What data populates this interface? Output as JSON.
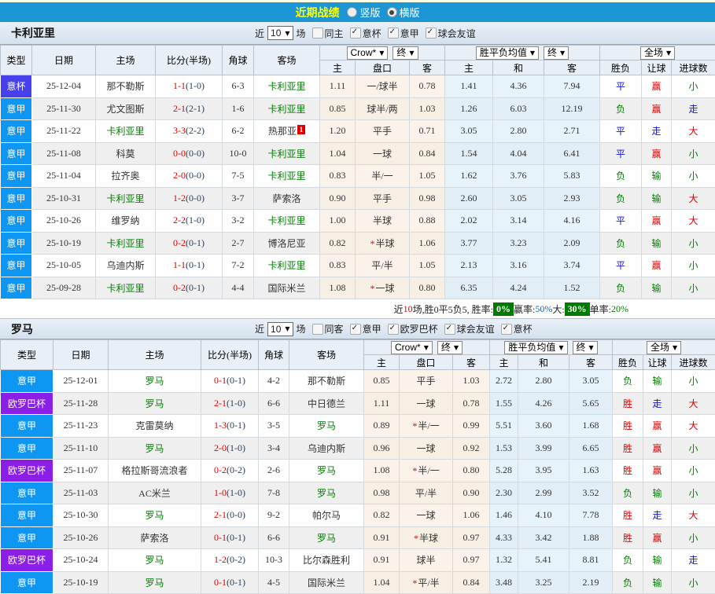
{
  "top_bar": {
    "title": "近期战绩",
    "options": [
      {
        "label": "竖版",
        "selected": false
      },
      {
        "label": "横版",
        "selected": true
      }
    ]
  },
  "league_colors": {
    "意甲": "#0D96F2",
    "意杯": "#4740EC",
    "欧罗巴杯": "#8B1FE8"
  },
  "result_colors": {
    "胜": "#E10000",
    "平": "#1010D8",
    "负": "#008000",
    "赢": "#E10000",
    "走": "#1010D8",
    "输": "#008000",
    "大": "#E10000",
    "小": "#008000"
  },
  "team_highlight_color": "#008000",
  "columns": {
    "left": [
      "类型",
      "日期",
      "主场",
      "比分(半场)",
      "角球",
      "客场"
    ],
    "group1": {
      "dropdown": "Crow*",
      "final": "终",
      "cols": [
        "主",
        "盘口",
        "客"
      ]
    },
    "group2": {
      "dropdown": "胜平负均值",
      "final": "终",
      "cols": [
        "主",
        "和",
        "客"
      ]
    },
    "group3": {
      "dropdown": "全场",
      "cols": [
        "胜负",
        "让球",
        "进球数"
      ]
    }
  },
  "sections": [
    {
      "team": "卡利亚里",
      "filters": {
        "near": "近",
        "count": "10",
        "unit": "场",
        "same": {
          "label": "同主",
          "checked": false
        },
        "leagues": [
          {
            "label": "意杯",
            "checked": true
          },
          {
            "label": "意甲",
            "checked": true
          },
          {
            "label": "球会友谊",
            "checked": true
          }
        ]
      },
      "rows": [
        {
          "league": "意杯",
          "date": "25-12-04",
          "home": "那不勒斯",
          "home_is_team": false,
          "score": "1-1",
          "half": "(1-0)",
          "corners": "6-3",
          "away": "卡利亚里",
          "away_is_team": true,
          "away_badge": "",
          "odds_home": "1.11",
          "handicap": "一/球半",
          "handicap_star": false,
          "odds_away": "0.78",
          "avg_home": "1.41",
          "avg_draw": "4.36",
          "avg_away": "7.94",
          "result": "平",
          "handicap_result": "赢",
          "goals_result": "小"
        },
        {
          "league": "意甲",
          "date": "25-11-30",
          "home": "尤文图斯",
          "home_is_team": false,
          "score": "2-1",
          "half": "(2-1)",
          "corners": "1-6",
          "away": "卡利亚里",
          "away_is_team": true,
          "away_badge": "",
          "odds_home": "0.85",
          "handicap": "球半/两",
          "handicap_star": false,
          "odds_away": "1.03",
          "avg_home": "1.26",
          "avg_draw": "6.03",
          "avg_away": "12.19",
          "result": "负",
          "handicap_result": "赢",
          "goals_result": "走"
        },
        {
          "league": "意甲",
          "date": "25-11-22",
          "home": "卡利亚里",
          "home_is_team": true,
          "score": "3-3",
          "half": "(2-2)",
          "corners": "6-2",
          "away": "热那亚",
          "away_is_team": false,
          "away_badge": "1",
          "odds_home": "1.20",
          "handicap": "平手",
          "handicap_star": false,
          "odds_away": "0.71",
          "avg_home": "3.05",
          "avg_draw": "2.80",
          "avg_away": "2.71",
          "result": "平",
          "handicap_result": "走",
          "goals_result": "大"
        },
        {
          "league": "意甲",
          "date": "25-11-08",
          "home": "科莫",
          "home_is_team": false,
          "score": "0-0",
          "half": "(0-0)",
          "corners": "10-0",
          "away": "卡利亚里",
          "away_is_team": true,
          "away_badge": "",
          "odds_home": "1.04",
          "handicap": "一球",
          "handicap_star": false,
          "odds_away": "0.84",
          "avg_home": "1.54",
          "avg_draw": "4.04",
          "avg_away": "6.41",
          "result": "平",
          "handicap_result": "赢",
          "goals_result": "小"
        },
        {
          "league": "意甲",
          "date": "25-11-04",
          "home": "拉齐奥",
          "home_is_team": false,
          "score": "2-0",
          "half": "(0-0)",
          "corners": "7-5",
          "away": "卡利亚里",
          "away_is_team": true,
          "away_badge": "",
          "odds_home": "0.83",
          "handicap": "半/一",
          "handicap_star": false,
          "odds_away": "1.05",
          "avg_home": "1.62",
          "avg_draw": "3.76",
          "avg_away": "5.83",
          "result": "负",
          "handicap_result": "输",
          "goals_result": "小"
        },
        {
          "league": "意甲",
          "date": "25-10-31",
          "home": "卡利亚里",
          "home_is_team": true,
          "score": "1-2",
          "half": "(0-0)",
          "corners": "3-7",
          "away": "萨索洛",
          "away_is_team": false,
          "away_badge": "",
          "odds_home": "0.90",
          "handicap": "平手",
          "handicap_star": false,
          "odds_away": "0.98",
          "avg_home": "2.60",
          "avg_draw": "3.05",
          "avg_away": "2.93",
          "result": "负",
          "handicap_result": "输",
          "goals_result": "大"
        },
        {
          "league": "意甲",
          "date": "25-10-26",
          "home": "维罗纳",
          "home_is_team": false,
          "score": "2-2",
          "half": "(1-0)",
          "corners": "3-2",
          "away": "卡利亚里",
          "away_is_team": true,
          "away_badge": "",
          "odds_home": "1.00",
          "handicap": "半球",
          "handicap_star": false,
          "odds_away": "0.88",
          "avg_home": "2.02",
          "avg_draw": "3.14",
          "avg_away": "4.16",
          "result": "平",
          "handicap_result": "赢",
          "goals_result": "大"
        },
        {
          "league": "意甲",
          "date": "25-10-19",
          "home": "卡利亚里",
          "home_is_team": true,
          "score": "0-2",
          "half": "(0-1)",
          "corners": "2-7",
          "away": "博洛尼亚",
          "away_is_team": false,
          "away_badge": "",
          "odds_home": "0.82",
          "handicap": "半球",
          "handicap_star": true,
          "odds_away": "1.06",
          "avg_home": "3.77",
          "avg_draw": "3.23",
          "avg_away": "2.09",
          "result": "负",
          "handicap_result": "输",
          "goals_result": "小"
        },
        {
          "league": "意甲",
          "date": "25-10-05",
          "home": "乌迪内斯",
          "home_is_team": false,
          "score": "1-1",
          "half": "(0-1)",
          "corners": "7-2",
          "away": "卡利亚里",
          "away_is_team": true,
          "away_badge": "",
          "odds_home": "0.83",
          "handicap": "平/半",
          "handicap_star": false,
          "odds_away": "1.05",
          "avg_home": "2.13",
          "avg_draw": "3.16",
          "avg_away": "3.74",
          "result": "平",
          "handicap_result": "赢",
          "goals_result": "小"
        },
        {
          "league": "意甲",
          "date": "25-09-28",
          "home": "卡利亚里",
          "home_is_team": true,
          "score": "0-2",
          "half": "(0-1)",
          "corners": "4-4",
          "away": "国际米兰",
          "away_is_team": false,
          "away_badge": "",
          "odds_home": "1.08",
          "handicap": "一球",
          "handicap_star": true,
          "odds_away": "0.80",
          "avg_home": "6.35",
          "avg_draw": "4.24",
          "avg_away": "1.52",
          "result": "负",
          "handicap_result": "输",
          "goals_result": "小"
        }
      ],
      "summary": [
        {
          "text": "近"
        },
        {
          "text": "10",
          "color": "#E10000"
        },
        {
          "text": "场,胜0平5负5, 胜率:"
        },
        {
          "text": "0%",
          "badge": true
        },
        {
          "text": "赢率:"
        },
        {
          "text": "50%",
          "color": "#0066CC"
        },
        {
          "text": " 大:"
        },
        {
          "text": "30%",
          "badge": true
        },
        {
          "text": "单率:"
        },
        {
          "text": "20%",
          "color": "#008000"
        }
      ]
    },
    {
      "team": "罗马",
      "filters": {
        "near": "近",
        "count": "10",
        "unit": "场",
        "same": {
          "label": "同客",
          "checked": false
        },
        "leagues": [
          {
            "label": "意甲",
            "checked": true
          },
          {
            "label": "欧罗巴杯",
            "checked": true
          },
          {
            "label": "球会友谊",
            "checked": true
          },
          {
            "label": "意杯",
            "checked": true
          }
        ]
      },
      "rows": [
        {
          "league": "意甲",
          "date": "25-12-01",
          "home": "罗马",
          "home_is_team": true,
          "score": "0-1",
          "half": "(0-1)",
          "corners": "4-2",
          "away": "那不勒斯",
          "away_is_team": false,
          "away_badge": "",
          "odds_home": "0.85",
          "handicap": "平手",
          "handicap_star": false,
          "odds_away": "1.03",
          "avg_home": "2.72",
          "avg_draw": "2.80",
          "avg_away": "3.05",
          "result": "负",
          "handicap_result": "输",
          "goals_result": "小"
        },
        {
          "league": "欧罗巴杯",
          "date": "25-11-28",
          "home": "罗马",
          "home_is_team": true,
          "score": "2-1",
          "half": "(1-0)",
          "corners": "6-6",
          "away": "中日德兰",
          "away_is_team": false,
          "away_badge": "",
          "odds_home": "1.11",
          "handicap": "一球",
          "handicap_star": false,
          "odds_away": "0.78",
          "avg_home": "1.55",
          "avg_draw": "4.26",
          "avg_away": "5.65",
          "result": "胜",
          "handicap_result": "走",
          "goals_result": "大"
        },
        {
          "league": "意甲",
          "date": "25-11-23",
          "home": "克雷莫纳",
          "home_is_team": false,
          "score": "1-3",
          "half": "(0-1)",
          "corners": "3-5",
          "away": "罗马",
          "away_is_team": true,
          "away_badge": "",
          "odds_home": "0.89",
          "handicap": "半/一",
          "handicap_star": true,
          "odds_away": "0.99",
          "avg_home": "5.51",
          "avg_draw": "3.60",
          "avg_away": "1.68",
          "result": "胜",
          "handicap_result": "赢",
          "goals_result": "大"
        },
        {
          "league": "意甲",
          "date": "25-11-10",
          "home": "罗马",
          "home_is_team": true,
          "score": "2-0",
          "half": "(1-0)",
          "corners": "3-4",
          "away": "乌迪内斯",
          "away_is_team": false,
          "away_badge": "",
          "odds_home": "0.96",
          "handicap": "一球",
          "handicap_star": false,
          "odds_away": "0.92",
          "avg_home": "1.53",
          "avg_draw": "3.99",
          "avg_away": "6.65",
          "result": "胜",
          "handicap_result": "赢",
          "goals_result": "小"
        },
        {
          "league": "欧罗巴杯",
          "date": "25-11-07",
          "home": "格拉斯哥流浪者",
          "home_is_team": false,
          "score": "0-2",
          "half": "(0-2)",
          "corners": "2-6",
          "away": "罗马",
          "away_is_team": true,
          "away_badge": "",
          "odds_home": "1.08",
          "handicap": "半/一",
          "handicap_star": true,
          "odds_away": "0.80",
          "avg_home": "5.28",
          "avg_draw": "3.95",
          "avg_away": "1.63",
          "result": "胜",
          "handicap_result": "赢",
          "goals_result": "小"
        },
        {
          "league": "意甲",
          "date": "25-11-03",
          "home": "AC米兰",
          "home_is_team": false,
          "score": "1-0",
          "half": "(1-0)",
          "corners": "7-8",
          "away": "罗马",
          "away_is_team": true,
          "away_badge": "",
          "odds_home": "0.98",
          "handicap": "平/半",
          "handicap_star": false,
          "odds_away": "0.90",
          "avg_home": "2.30",
          "avg_draw": "2.99",
          "avg_away": "3.52",
          "result": "负",
          "handicap_result": "输",
          "goals_result": "小"
        },
        {
          "league": "意甲",
          "date": "25-10-30",
          "home": "罗马",
          "home_is_team": true,
          "score": "2-1",
          "half": "(0-0)",
          "corners": "9-2",
          "away": "帕尔马",
          "away_is_team": false,
          "away_badge": "",
          "odds_home": "0.82",
          "handicap": "一球",
          "handicap_star": false,
          "odds_away": "1.06",
          "avg_home": "1.46",
          "avg_draw": "4.10",
          "avg_away": "7.78",
          "result": "胜",
          "handicap_result": "走",
          "goals_result": "大"
        },
        {
          "league": "意甲",
          "date": "25-10-26",
          "home": "萨索洛",
          "home_is_team": false,
          "score": "0-1",
          "half": "(0-1)",
          "corners": "6-6",
          "away": "罗马",
          "away_is_team": true,
          "away_badge": "",
          "odds_home": "0.91",
          "handicap": "半球",
          "handicap_star": true,
          "odds_away": "0.97",
          "avg_home": "4.33",
          "avg_draw": "3.42",
          "avg_away": "1.88",
          "result": "胜",
          "handicap_result": "赢",
          "goals_result": "小"
        },
        {
          "league": "欧罗巴杯",
          "date": "25-10-24",
          "home": "罗马",
          "home_is_team": true,
          "score": "1-2",
          "half": "(0-2)",
          "corners": "10-3",
          "away": "比尔森胜利",
          "away_is_team": false,
          "away_badge": "",
          "odds_home": "0.91",
          "handicap": "球半",
          "handicap_star": false,
          "odds_away": "0.97",
          "avg_home": "1.32",
          "avg_draw": "5.41",
          "avg_away": "8.81",
          "result": "负",
          "handicap_result": "输",
          "goals_result": "走"
        },
        {
          "league": "意甲",
          "date": "25-10-19",
          "home": "罗马",
          "home_is_team": true,
          "score": "0-1",
          "half": "(0-1)",
          "corners": "4-5",
          "away": "国际米兰",
          "away_is_team": false,
          "away_badge": "",
          "odds_home": "1.04",
          "handicap": "平/半",
          "handicap_star": true,
          "odds_away": "0.84",
          "avg_home": "3.48",
          "avg_draw": "3.25",
          "avg_away": "2.19",
          "result": "负",
          "handicap_result": "输",
          "goals_result": "小"
        }
      ],
      "summary": []
    }
  ]
}
